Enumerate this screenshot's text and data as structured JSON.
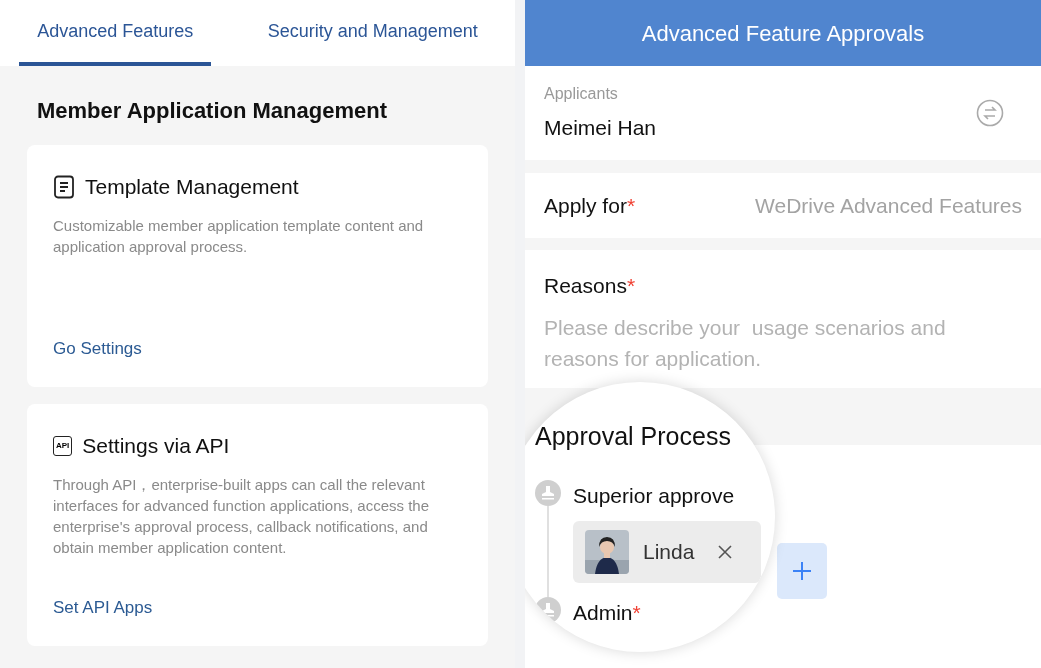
{
  "tabs": [
    {
      "label": "Advanced Features",
      "selected": true
    },
    {
      "label": "Security and Management",
      "selected": false
    }
  ],
  "section_title": "Member Application Management",
  "cards": [
    {
      "kind": "template",
      "title": "Template Management",
      "description": "Customizable member application template content and application approval process.",
      "link": "Go Settings"
    },
    {
      "kind": "api",
      "icon_label": "API",
      "title": "Settings via API",
      "description": "Through API，enterprise-built apps can call the relevant interfaces for advanced function applications, access the enterprise's approval process, callback notifications, and obtain member application content.",
      "link": "Set API Apps"
    }
  ],
  "form": {
    "title": "Advanced Feature Approvals",
    "applicant": {
      "label": "Applicants",
      "value": "Meimei Han"
    },
    "apply_for": {
      "label": "Apply for",
      "required_mark": "*",
      "value": "WeDrive Advanced Features"
    },
    "reasons": {
      "label": "Reasons",
      "required_mark": "*",
      "placeholder": "Please describe your  usage scenarios and reasons for application."
    }
  },
  "magnifier": {
    "title": "Approval Process",
    "steps": [
      {
        "label": "Superior approve",
        "approvers": [
          {
            "name": "Linda",
            "kind": "picture"
          }
        ]
      },
      {
        "label": "Admin",
        "required_mark": "*"
      }
    ]
  }
}
